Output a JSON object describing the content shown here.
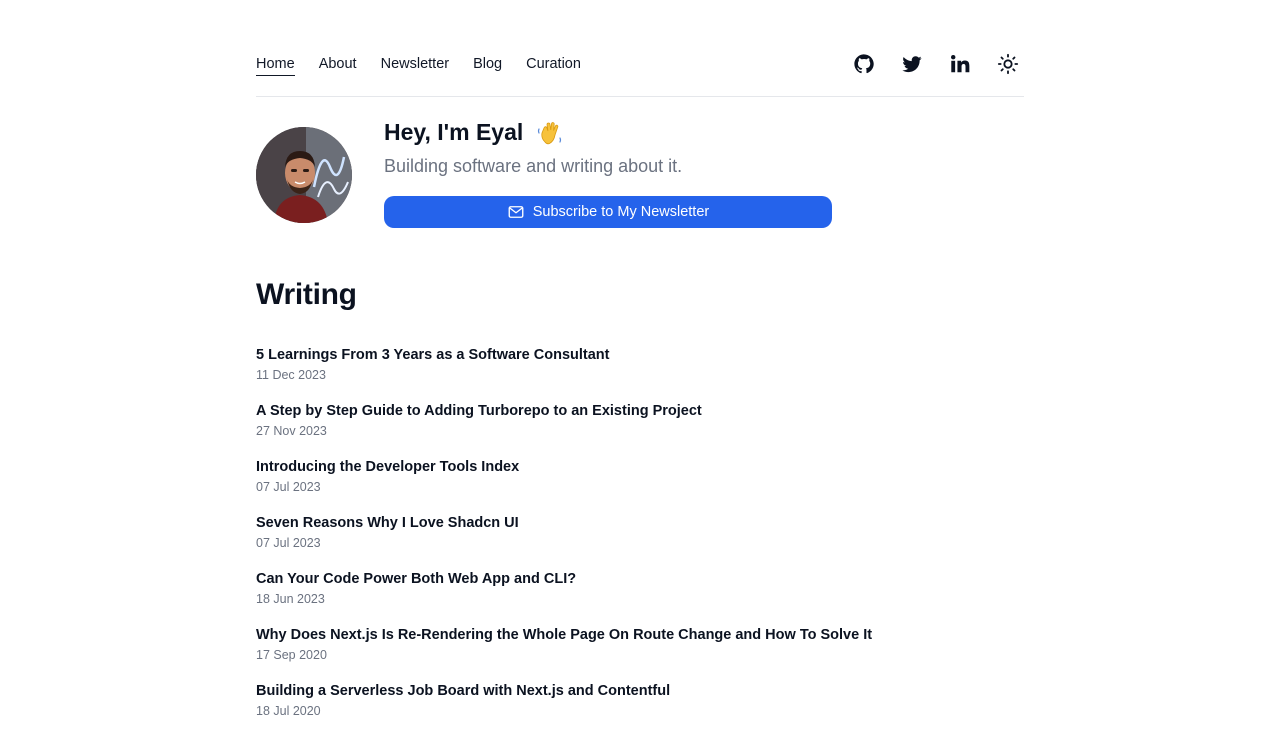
{
  "nav": {
    "links": [
      "Home",
      "About",
      "Newsletter",
      "Blog",
      "Curation"
    ],
    "active": "Home",
    "icons": [
      "github-icon",
      "twitter-icon",
      "linkedin-icon",
      "sun-icon"
    ]
  },
  "intro": {
    "greeting": "Hey, I'm Eyal",
    "tagline": "Building software and writing about it.",
    "subscribe_label": "Subscribe to My Newsletter"
  },
  "writing": {
    "title": "Writing",
    "posts": [
      {
        "title": "5 Learnings From 3 Years as a Software Consultant",
        "date": "11 Dec 2023"
      },
      {
        "title": "A Step by Step Guide to Adding Turborepo to an Existing Project",
        "date": "27 Nov 2023"
      },
      {
        "title": "Introducing the Developer Tools Index",
        "date": "07 Jul 2023"
      },
      {
        "title": "Seven Reasons Why I Love Shadcn UI",
        "date": "07 Jul 2023"
      },
      {
        "title": "Can Your Code Power Both Web App and CLI?",
        "date": "18 Jun 2023"
      },
      {
        "title": "Why Does Next.js Is Re-Rendering the Whole Page On Route Change and How To Solve It",
        "date": "17 Sep 2020"
      },
      {
        "title": "Building a Serverless Job Board with Next.js and Contentful",
        "date": "18 Jul 2020"
      }
    ]
  },
  "colors": {
    "accent": "#2563eb",
    "text": "#0b1220",
    "muted": "#6b7280"
  }
}
